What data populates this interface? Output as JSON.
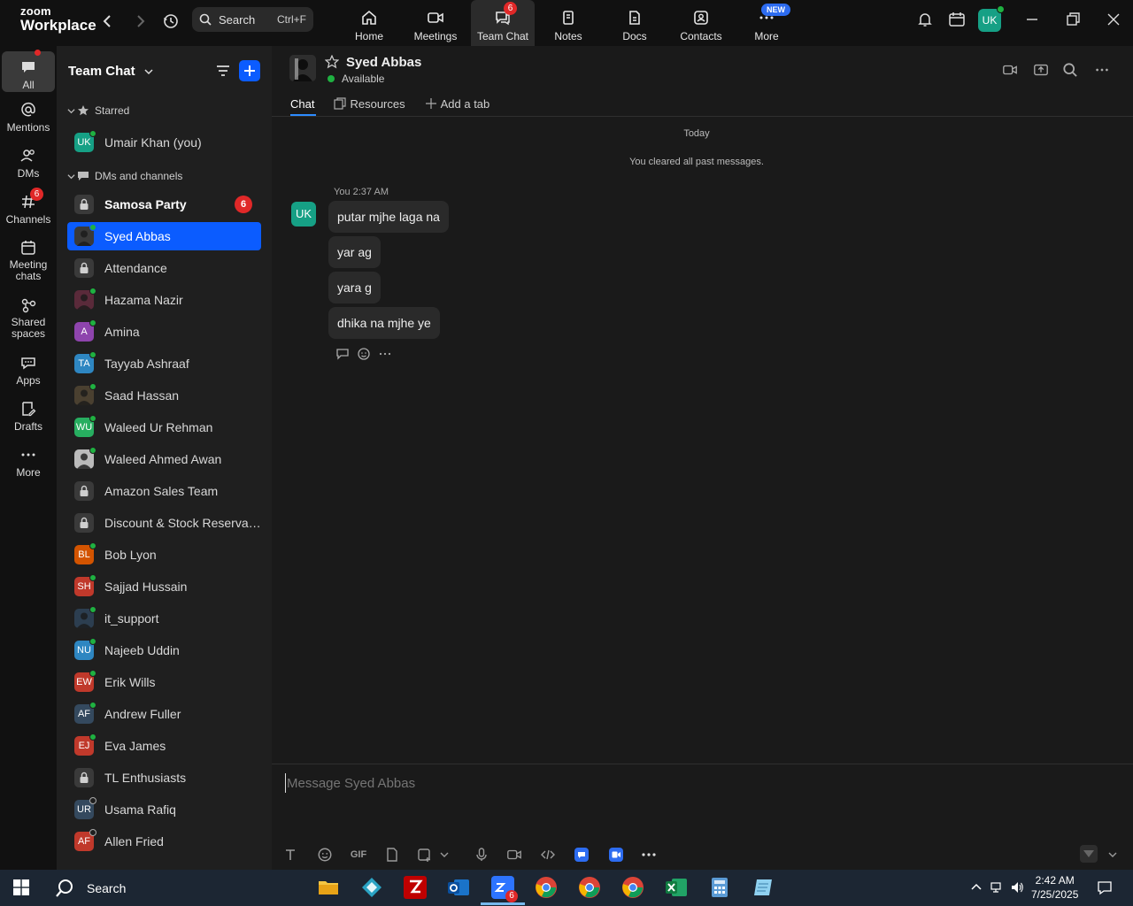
{
  "app": {
    "logo_line1": "zoom",
    "logo_line2": "Workplace"
  },
  "search": {
    "label": "Search",
    "shortcut": "Ctrl+F"
  },
  "top_tabs": [
    {
      "label": "Home",
      "icon": "home-icon"
    },
    {
      "label": "Meetings",
      "icon": "video-icon"
    },
    {
      "label": "Team Chat",
      "icon": "chat-icon",
      "badge": "6",
      "active": true
    },
    {
      "label": "Notes",
      "icon": "notes-icon"
    },
    {
      "label": "Docs",
      "icon": "docs-icon"
    },
    {
      "label": "Contacts",
      "icon": "contacts-icon"
    },
    {
      "label": "More",
      "icon": "more-icon",
      "badge": "NEW"
    }
  ],
  "user": {
    "initials": "UK"
  },
  "rail": [
    {
      "label": "All",
      "icon": "chat-bubble-icon",
      "active": true
    },
    {
      "label": "Mentions",
      "icon": "at-icon"
    },
    {
      "label": "DMs",
      "icon": "people-icon"
    },
    {
      "label": "Channels",
      "icon": "hash-icon",
      "badge": "6"
    },
    {
      "label": "Meeting chats",
      "icon": "calendar-icon"
    },
    {
      "label": "Shared spaces",
      "icon": "shared-spaces-icon"
    },
    {
      "label": "Apps",
      "icon": "apps-icon"
    },
    {
      "label": "Drafts",
      "icon": "drafts-icon"
    },
    {
      "label": "More",
      "icon": "ellipsis-icon"
    }
  ],
  "sidebar": {
    "title": "Team Chat",
    "starred_label": "Starred",
    "starred": [
      {
        "name": "Umair Khan (you)",
        "initials": "UK",
        "color": "#16a085",
        "status": "online"
      }
    ],
    "dms_label": "DMs and channels",
    "items": [
      {
        "name": "Samosa Party",
        "type": "channel",
        "bold": true,
        "badge": "6"
      },
      {
        "name": "Syed Abbas",
        "type": "photo",
        "selected": true,
        "status": "online"
      },
      {
        "name": "Attendance",
        "type": "channel"
      },
      {
        "name": "Hazama Nazir",
        "type": "photo",
        "color": "#5a2a3a",
        "status": "online"
      },
      {
        "name": "Amina",
        "initials": "A",
        "color": "#8e44ad",
        "status": "mobile"
      },
      {
        "name": "Tayyab Ashraaf",
        "initials": "TA",
        "color": "#2e86c1",
        "status": "online"
      },
      {
        "name": "Saad Hassan",
        "type": "photo",
        "color": "#4a4030",
        "status": "online"
      },
      {
        "name": "Waleed Ur Rehman",
        "initials": "WU",
        "color": "#27ae60",
        "status": "online"
      },
      {
        "name": "Waleed Ahmed Awan",
        "type": "photo",
        "color": "#bbbbbb",
        "status": "online"
      },
      {
        "name": "Amazon Sales Team",
        "type": "channel"
      },
      {
        "name": "Discount & Stock Reservati...",
        "type": "channel"
      },
      {
        "name": "Bob Lyon",
        "initials": "BL",
        "color": "#d35400",
        "status": "online"
      },
      {
        "name": "Sajjad Hussain",
        "initials": "SH",
        "color": "#c0392b",
        "status": "online"
      },
      {
        "name": "it_support",
        "type": "photo",
        "color": "#2c3e50",
        "status": "online"
      },
      {
        "name": "Najeeb Uddin",
        "initials": "NU",
        "color": "#2e86c1",
        "status": "online"
      },
      {
        "name": "Erik Wills",
        "initials": "EW",
        "color": "#c0392b",
        "status": "online"
      },
      {
        "name": "Andrew Fuller",
        "initials": "AF",
        "color": "#34495e",
        "status": "online"
      },
      {
        "name": "Eva James",
        "initials": "EJ",
        "color": "#c0392b",
        "status": "online"
      },
      {
        "name": "TL Enthusiasts",
        "type": "channel"
      },
      {
        "name": "Usama Rafiq",
        "initials": "UR",
        "color": "#34495e",
        "status": "offline"
      },
      {
        "name": "Allen Fried",
        "initials": "AF",
        "color": "#c0392b",
        "status": "offline"
      }
    ]
  },
  "chat": {
    "contact_name": "Syed Abbas",
    "contact_status": "Available",
    "tabs": [
      "Chat",
      "Resources",
      "Add a tab"
    ],
    "date_divider": "Today",
    "system_note": "You cleared all past messages.",
    "sender_initials": "UK",
    "sender_meta": "You 2:37 AM",
    "messages": [
      "putar mjhe laga na",
      "yar ag",
      "yara g",
      "dhika na mjhe ye"
    ],
    "composer_placeholder": "Message Syed Abbas",
    "gif_label": "GIF"
  },
  "taskbar": {
    "search_label": "Search",
    "time": "2:42 AM",
    "date": "7/25/2025",
    "zoom_badge": "6"
  }
}
